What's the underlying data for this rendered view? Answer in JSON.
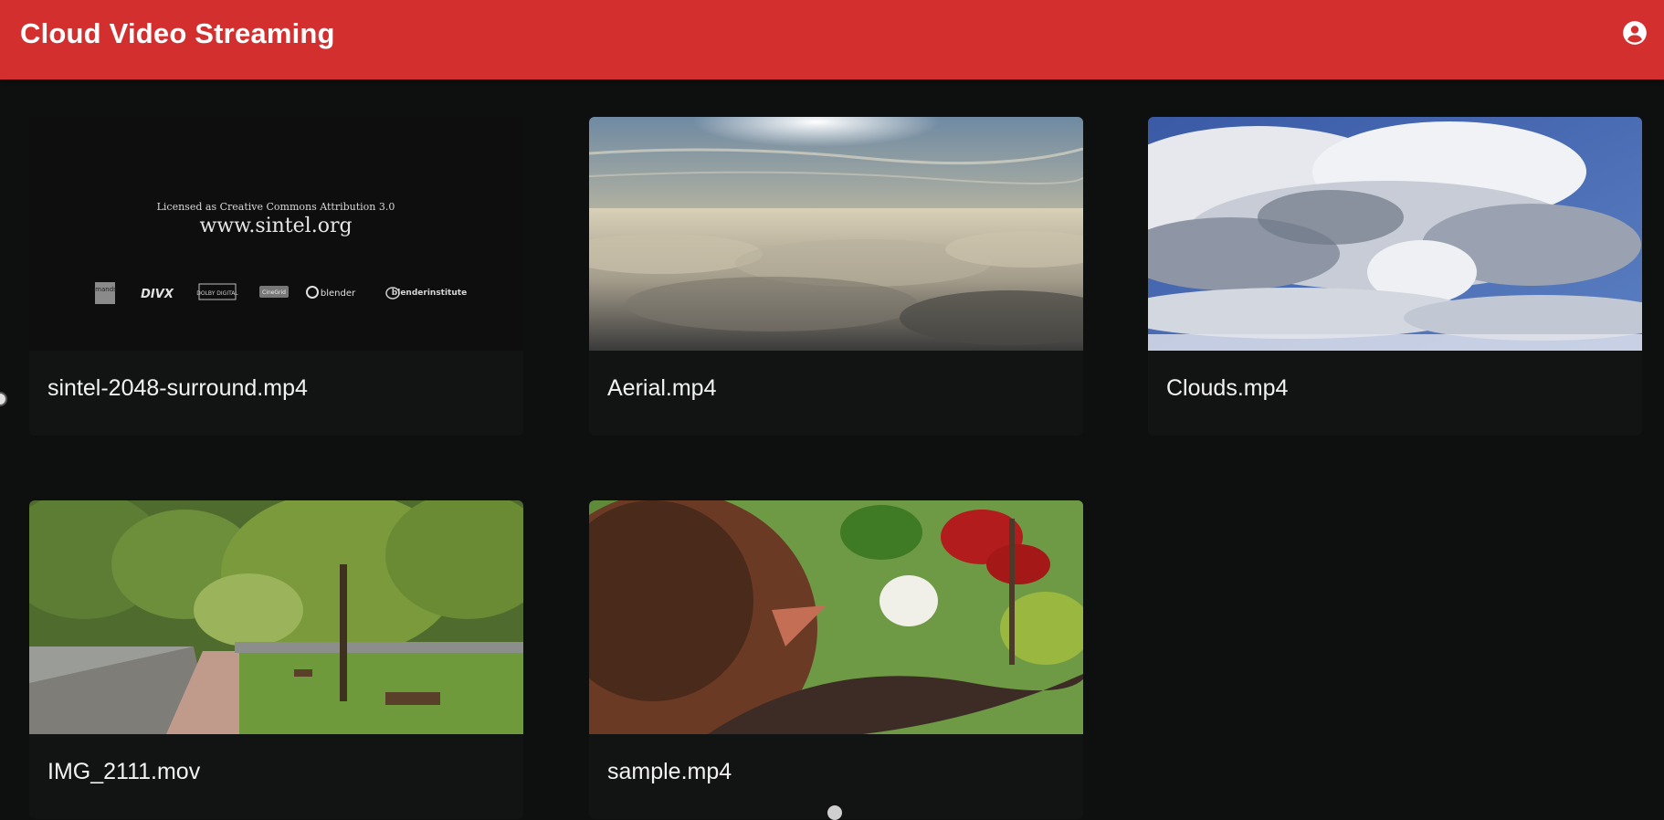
{
  "app": {
    "title": "Cloud Video Streaming",
    "account_icon": "account-circle-icon",
    "brand_color": "#d32f2f",
    "background_color": "#0e0f0f"
  },
  "videos": [
    {
      "filename": "sintel-2048-surround.mp4",
      "thumbnail": {
        "license_line": "Licensed as Creative Commons Attribution 3.0",
        "url_line": "www.sintel.org",
        "logos": [
          "imands",
          "DIVX",
          "DOLBY DIGITAL",
          "CineGrid",
          "blender",
          "blenderinstitute"
        ]
      }
    },
    {
      "filename": "Aerial.mp4"
    },
    {
      "filename": "Clouds.mp4"
    },
    {
      "filename": "IMG_2111.mov"
    },
    {
      "filename": "sample.mp4"
    }
  ]
}
